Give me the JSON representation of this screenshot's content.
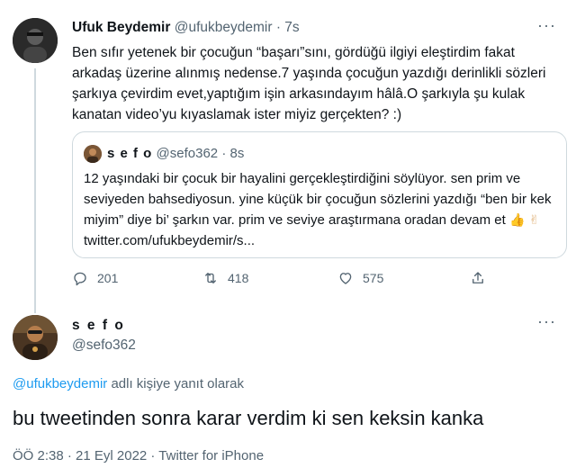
{
  "main_tweet": {
    "name": "Ufuk Beydemir",
    "handle": "@ufukbeydemir",
    "time": "· 7s",
    "text": "Ben sıfır yetenek bir çocuğun “başarı”sını, gördüğü ilgiyi eleştirdim fakat arkadaş üzerine alınmış nedense.7 yaşında çocuğun yazdığı derinlikli sözleri şarkıya çevirdim evet,yaptığım işin arkasındayım hâlâ.O şarkıyla şu kulak kanatan video’yu kıyaslamak ister miyiz gerçekten? :)",
    "more": "···",
    "quoted": {
      "name": "s e f o",
      "handle": "@sefo362",
      "time": "· 8s",
      "text_before_emoji": "12 yaşındaki bir çocuk bir hayalini gerçekleştirdiğini söylüyor. sen prim ve seviyeden bahsediyosun. yine küçük bir çocuğun sözlerini yazdığı “ben bir kek miyim” diye bi’ şarkın var. prim ve seviye araştırmana oradan devam et",
      "emoji_1": "👍",
      "emoji_2": "✌",
      "link": "twitter.com/ufukbeydemir/s..."
    },
    "actions": {
      "reply_count": "201",
      "retweet_count": "418",
      "like_count": "575"
    }
  },
  "reply_tweet": {
    "name": "s e f o",
    "handle": "@sefo362",
    "more": "···",
    "reply_to_mention": "@ufukbeydemir",
    "reply_to_suffix": " adlı kişiye yanıt olarak",
    "text": "bu tweetinden sonra karar verdim ki sen keksin kanka",
    "meta": "ÖÖ 2:38 · 21 Eyl 2022 · Twitter for iPhone"
  },
  "icons": {
    "reply": "reply-icon",
    "retweet": "retweet-icon",
    "like": "heart-icon",
    "share": "share-icon"
  },
  "colors": {
    "link": "#1d9bf0",
    "secondary_text": "#536471",
    "border": "#cfd9de"
  }
}
